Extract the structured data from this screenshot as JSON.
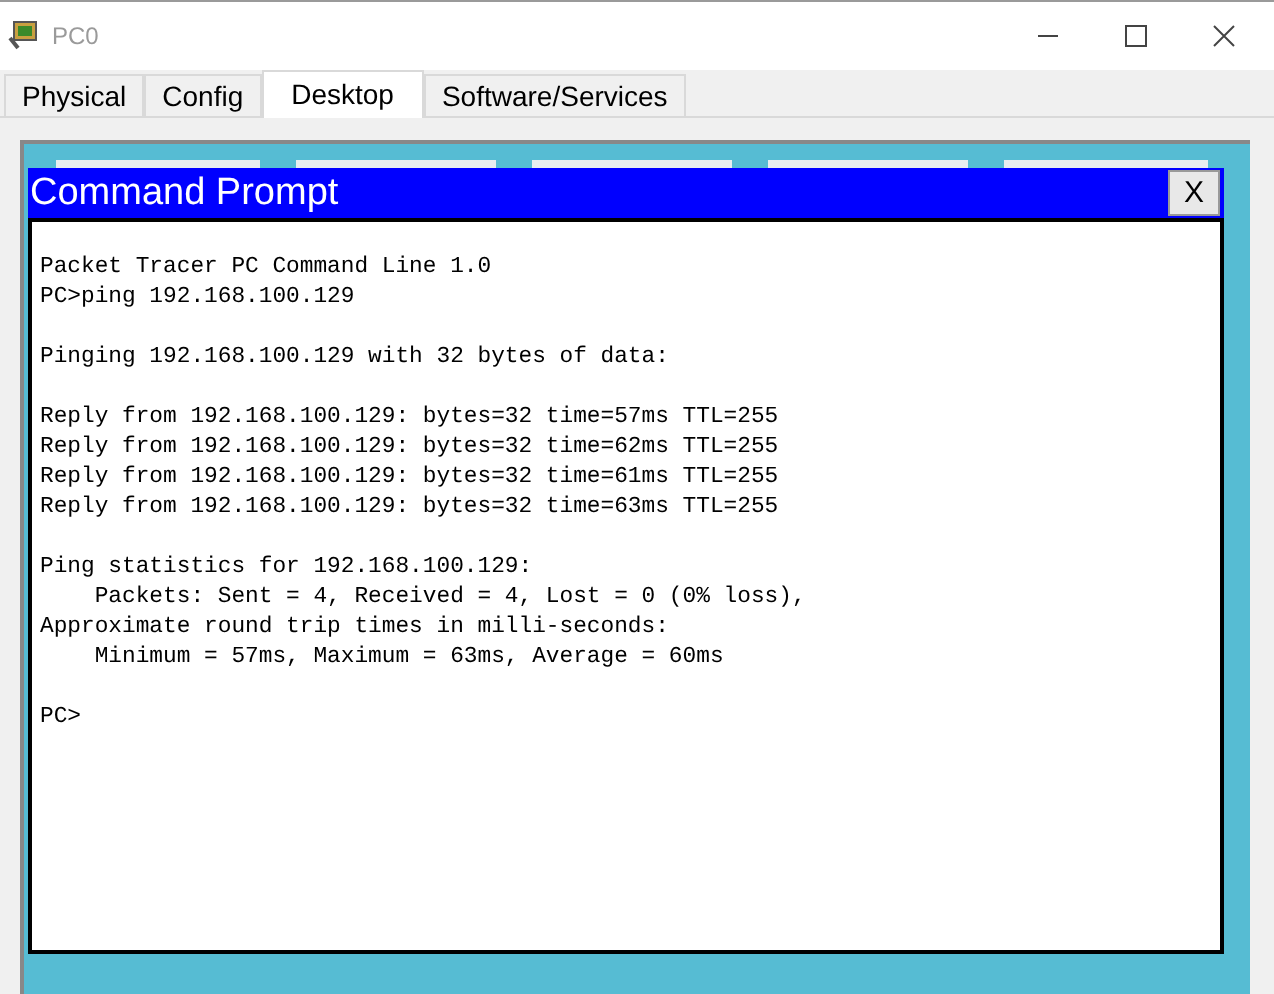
{
  "window": {
    "title": "PC0"
  },
  "tabs": [
    {
      "label": "Physical",
      "selected": false
    },
    {
      "label": "Config",
      "selected": false
    },
    {
      "label": "Desktop",
      "selected": true
    },
    {
      "label": "Software/Services",
      "selected": false
    }
  ],
  "command_prompt": {
    "title": "Command Prompt",
    "close_label": "X",
    "blocks": [
      [
        "Packet Tracer PC Command Line 1.0",
        "PC>ping 192.168.100.129"
      ],
      [
        "Pinging 192.168.100.129 with 32 bytes of data:"
      ],
      [
        "Reply from 192.168.100.129: bytes=32 time=57ms TTL=255",
        "Reply from 192.168.100.129: bytes=32 time=62ms TTL=255",
        "Reply from 192.168.100.129: bytes=32 time=61ms TTL=255",
        "Reply from 192.168.100.129: bytes=32 time=63ms TTL=255"
      ],
      [
        "Ping statistics for 192.168.100.129:",
        "    Packets: Sent = 4, Received = 4, Lost = 0 (0% loss),",
        "Approximate round trip times in milli-seconds:",
        "    Minimum = 57ms, Maximum = 63ms, Average = 60ms"
      ],
      [
        "PC>"
      ]
    ]
  }
}
